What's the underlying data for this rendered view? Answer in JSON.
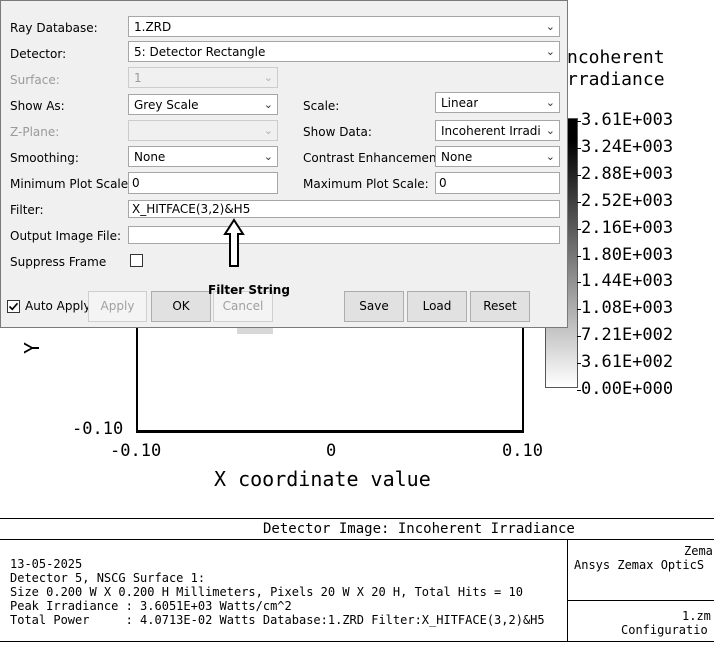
{
  "plot": {
    "y_axis_label": "Y",
    "x_axis_label": "X coordinate value",
    "y_tick_bottom": "-0.10",
    "x_ticks": [
      "-0.10",
      "0",
      "0.10"
    ],
    "colorbar_title_1": "ncoherent",
    "colorbar_title_2": "rradiance",
    "colorbar_labels": [
      "3.61E+003",
      "3.24E+003",
      "2.88E+003",
      "2.52E+003",
      "2.16E+003",
      "1.80E+003",
      "1.44E+003",
      "1.08E+003",
      "7.21E+002",
      "3.61E+002",
      "0.00E+000"
    ]
  },
  "footer": {
    "title": "Detector Image: Incoherent Irradiance",
    "lines": [
      "13-05-2025",
      "Detector 5, NSCG Surface 1:",
      "Size 0.200 W X 0.200 H Millimeters, Pixels 20 W X 20 H, Total Hits = 10",
      "Peak Irradiance : 3.6051E+03 Watts/cm^2",
      "Total Power     : 4.0713E-02 Watts Database:1.ZRD Filter:X_HITFACE(3,2)&H5"
    ],
    "right_top_1": "Zema",
    "right_top_2": "Ansys Zemax OpticS",
    "right_bottom_1": "1.zm",
    "right_bottom_2": "Configuratio"
  },
  "dialog": {
    "ray_database_label": "Ray Database:",
    "ray_database_value": "1.ZRD",
    "detector_label": "Detector:",
    "detector_value": "5: Detector Rectangle",
    "surface_label": "Surface:",
    "surface_value": "1",
    "show_as_label": "Show As:",
    "show_as_value": "Grey Scale",
    "scale_label": "Scale:",
    "scale_value": "Linear",
    "z_plane_label": "Z-Plane:",
    "z_plane_value": "",
    "show_data_label": "Show Data:",
    "show_data_value": "Incoherent Irradiar",
    "smoothing_label": "Smoothing:",
    "smoothing_value": "None",
    "contrast_label": "Contrast Enhancement:",
    "contrast_value": "None",
    "min_scale_label": "Minimum Plot Scale:",
    "min_scale_value": "0",
    "max_scale_label": "Maximum Plot Scale:",
    "max_scale_value": "0",
    "filter_label": "Filter:",
    "filter_value": "X_HITFACE(3,2)&H5",
    "output_label": "Output Image File:",
    "output_value": "",
    "suppress_label": "Suppress Frame",
    "suppress_checked": false,
    "auto_apply_label": "Auto Apply",
    "auto_apply_checked": true,
    "apply_label": "Apply",
    "ok_label": "OK",
    "cancel_label": "Cancel",
    "save_label": "Save",
    "load_label": "Load",
    "reset_label": "Reset",
    "dropdown_icon": "chevron-down-icon",
    "check_icon": "checkmark-icon"
  },
  "annotation": {
    "text": "Filter String",
    "icon": "up-arrow-icon"
  }
}
